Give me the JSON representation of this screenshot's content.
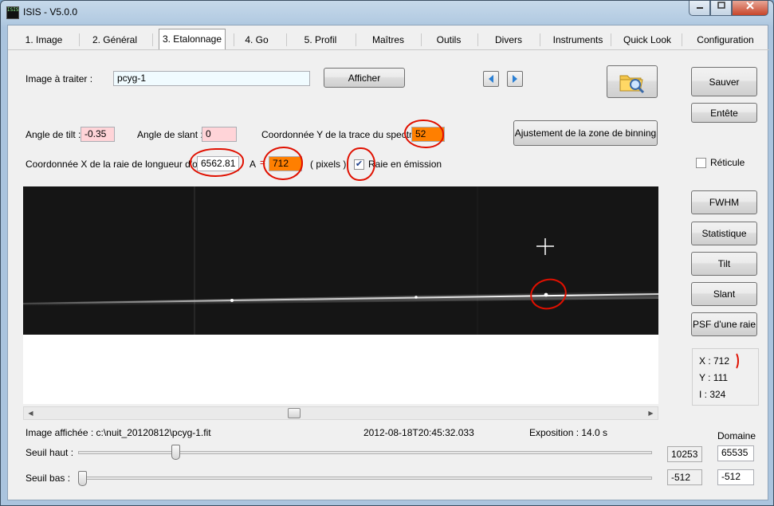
{
  "window": {
    "title": "ISIS - V5.0.0",
    "icon_text": "ISIS"
  },
  "tabs": [
    {
      "label": "1. Image"
    },
    {
      "label": "2. Général"
    },
    {
      "label": "3. Etalonnage"
    },
    {
      "label": "4. Go"
    },
    {
      "label": "5. Profil"
    },
    {
      "label": "Maîtres"
    },
    {
      "label": "Outils"
    },
    {
      "label": "Divers"
    },
    {
      "label": "Instruments"
    },
    {
      "label": "Quick Look"
    },
    {
      "label": "Configuration"
    }
  ],
  "active_tab": "3. Etalonnage",
  "image_row": {
    "label": "Image à traiter :",
    "value": "pcyg-1",
    "afficher_label": "Afficher"
  },
  "tilt": {
    "label": "Angle de tilt :",
    "value": "-0.35"
  },
  "slant": {
    "label": "Angle de slant :",
    "value": "0"
  },
  "trace_y": {
    "label": "Coordonnée Y de la trace du spectre :",
    "value": "52"
  },
  "binning_button": "Ajustement de la zone de binning",
  "wavelength": {
    "label": "Coordonnée X de la raie de longueur d'onde",
    "value": "6562.81",
    "a_label": "A",
    "x_value": "712",
    "pixels_label": "( pixels )",
    "emission_label": "Raie en émission",
    "emission_checked": true
  },
  "right_panel": {
    "save": "Sauver",
    "header": "Entête",
    "reticle_label": "Réticule",
    "reticle_checked": false,
    "fwhm": "FWHM",
    "stats": "Statistique",
    "tilt": "Tilt",
    "slant": "Slant",
    "psf": "PSF d'une raie"
  },
  "cursor_info": {
    "x": "X : 712",
    "y": "Y : 111",
    "i": "I : 324"
  },
  "status": {
    "image_path": "Image affichée : c:\\nuit_20120812\\pcyg-1.fit",
    "date": "2012-08-18T20:45:32.033",
    "exposure": "Exposition : 14.0 s"
  },
  "thresholds": {
    "domain_label": "Domaine",
    "high_label": "Seuil haut :",
    "high_value": "10253",
    "high_domain": "65535",
    "high_level": 0.162,
    "low_label": "Seuil bas :",
    "low_value": "-512",
    "low_domain": "-512",
    "low_level": 0.0
  },
  "scroll": {
    "position": 0.42
  },
  "colors": {
    "orange_field": "#ff7f00",
    "pink_field": "#ffd4d8",
    "annotation": "#e01000"
  }
}
